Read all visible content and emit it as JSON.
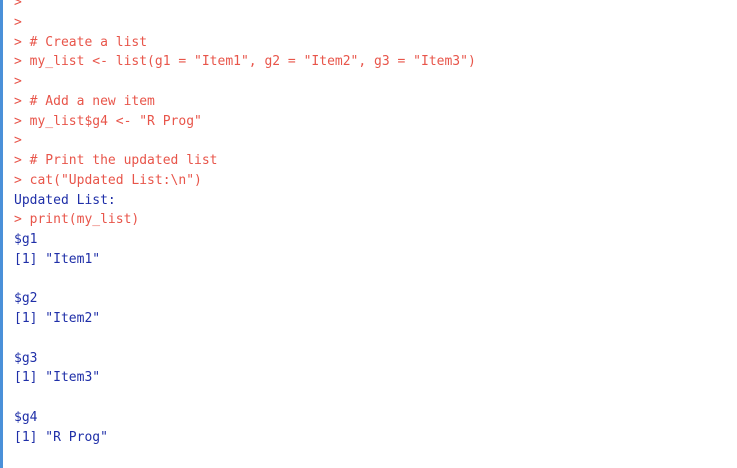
{
  "console": {
    "prompt_symbol": ">",
    "lines": [
      {
        "kind": "input",
        "text": ""
      },
      {
        "kind": "input",
        "text": ""
      },
      {
        "kind": "input",
        "text": "# Create a list"
      },
      {
        "kind": "input",
        "text": "my_list <- list(g1 = \"Item1\", g2 = \"Item2\", g3 = \"Item3\")"
      },
      {
        "kind": "input",
        "text": ""
      },
      {
        "kind": "input",
        "text": "# Add a new item"
      },
      {
        "kind": "input",
        "text": "my_list$g4 <- \"R Prog\""
      },
      {
        "kind": "input",
        "text": ""
      },
      {
        "kind": "input",
        "text": "# Print the updated list"
      },
      {
        "kind": "input",
        "text": "cat(\"Updated List:\\n\")"
      },
      {
        "kind": "output",
        "text": "Updated List:"
      },
      {
        "kind": "input",
        "text": "print(my_list)"
      },
      {
        "kind": "output",
        "text": "$g1"
      },
      {
        "kind": "output",
        "text": "[1] \"Item1\""
      },
      {
        "kind": "output",
        "text": ""
      },
      {
        "kind": "output",
        "text": "$g2"
      },
      {
        "kind": "output",
        "text": "[1] \"Item2\""
      },
      {
        "kind": "output",
        "text": ""
      },
      {
        "kind": "output",
        "text": "$g3"
      },
      {
        "kind": "output",
        "text": "[1] \"Item3\""
      },
      {
        "kind": "output",
        "text": ""
      },
      {
        "kind": "output",
        "text": "$g4"
      },
      {
        "kind": "output",
        "text": "[1] \"R Prog\""
      }
    ]
  },
  "colors": {
    "input_text": "#e8554a",
    "output_text": "#1f2fa8",
    "left_bar": "#4a90d9"
  }
}
